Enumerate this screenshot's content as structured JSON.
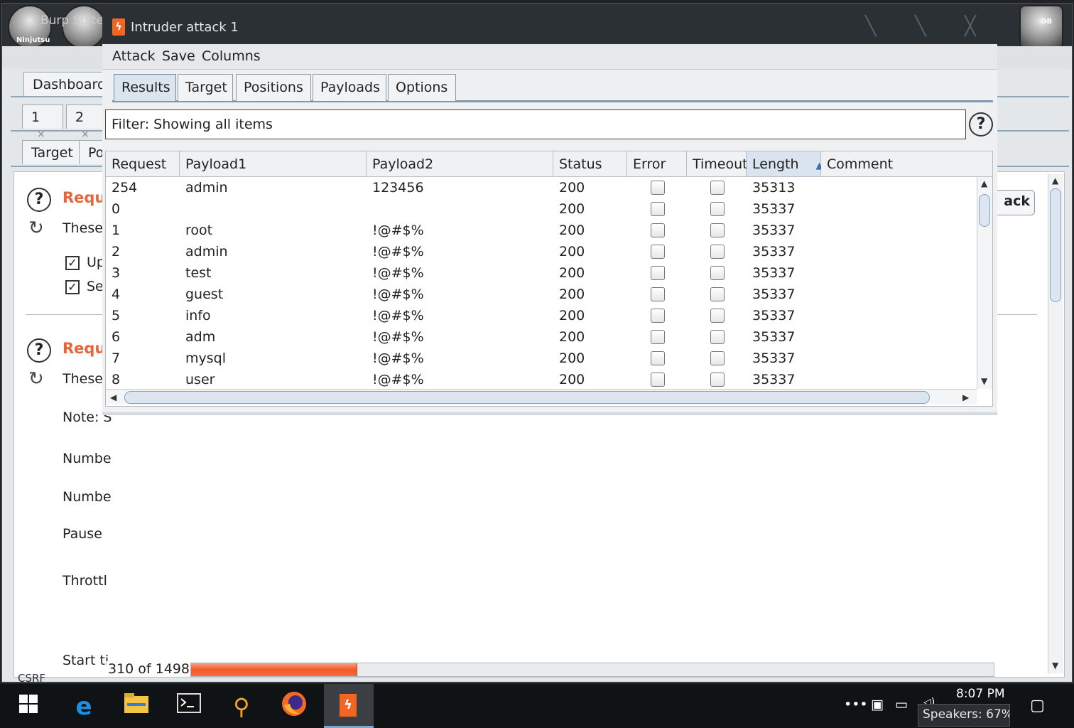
{
  "main_window": {
    "title": "Burp Suite",
    "desktop_icon_label": "Ninjutsu",
    "desktop_icon_right_label": "OB",
    "tabs_top": [
      "Dashboard"
    ],
    "tabs_numbered": [
      {
        "label": "1",
        "close": "×"
      },
      {
        "label": "2",
        "close": "×"
      }
    ],
    "tabs_sub": [
      "Target",
      "Po"
    ],
    "section1_heading": "Requ",
    "section1_text": "These",
    "check1_label": "Up",
    "check2_label": "Se",
    "section2_heading": "Requ",
    "section2_text": "These",
    "note_label": "Note: S",
    "number1_label": "Numbe",
    "number2_label": "Numbe",
    "pause_label": "Pause",
    "throttle_label": "Throttl",
    "start_label": "Start ti",
    "csrf_label": "CSRF",
    "attack_button": "ack"
  },
  "attack_window": {
    "title": "Intruder attack 1",
    "menu": [
      "Attack",
      "Save",
      "Columns"
    ],
    "tabs": [
      "Results",
      "Target",
      "Positions",
      "Payloads",
      "Options"
    ],
    "active_tab": "Results",
    "filter_text": "Filter: Showing all items",
    "columns": [
      "Request",
      "Payload1",
      "Payload2",
      "Status",
      "Error",
      "Timeout",
      "Length",
      "Comment"
    ],
    "sorted_column": "Length",
    "rows": [
      {
        "request": "254",
        "payload1": "admin",
        "payload2": "123456",
        "status": "200",
        "length": "35313",
        "comment": ""
      },
      {
        "request": "0",
        "payload1": "",
        "payload2": "",
        "status": "200",
        "length": "35337",
        "comment": ""
      },
      {
        "request": "1",
        "payload1": "root",
        "payload2": "!@#$%",
        "status": "200",
        "length": "35337",
        "comment": ""
      },
      {
        "request": "2",
        "payload1": "admin",
        "payload2": "!@#$%",
        "status": "200",
        "length": "35337",
        "comment": ""
      },
      {
        "request": "3",
        "payload1": "test",
        "payload2": "!@#$%",
        "status": "200",
        "length": "35337",
        "comment": ""
      },
      {
        "request": "4",
        "payload1": "guest",
        "payload2": "!@#$%",
        "status": "200",
        "length": "35337",
        "comment": ""
      },
      {
        "request": "5",
        "payload1": "info",
        "payload2": "!@#$%",
        "status": "200",
        "length": "35337",
        "comment": ""
      },
      {
        "request": "6",
        "payload1": "adm",
        "payload2": "!@#$%",
        "status": "200",
        "length": "35337",
        "comment": ""
      },
      {
        "request": "7",
        "payload1": "mysql",
        "payload2": "!@#$%",
        "status": "200",
        "length": "35337",
        "comment": ""
      },
      {
        "request": "8",
        "payload1": "user",
        "payload2": "!@#$%",
        "status": "200",
        "length": "35337",
        "comment": ""
      }
    ],
    "progress_text": "310 of 1498",
    "progress_done": 310,
    "progress_total": 1498,
    "accent_color": "#f2582a"
  },
  "taskbar": {
    "time": "8:07 PM",
    "tooltip": "Speakers: 67%",
    "overflow": "•••",
    "icons": [
      "windows-start-icon",
      "edge-icon",
      "file-explorer-icon",
      "terminal-icon",
      "search-icon",
      "firefox-icon",
      "burp-icon"
    ]
  }
}
